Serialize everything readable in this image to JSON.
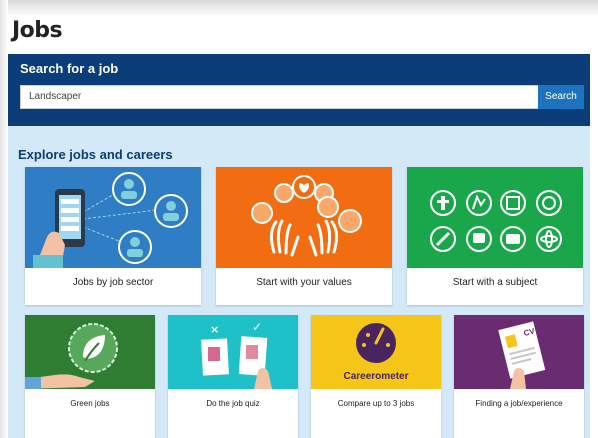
{
  "page": {
    "title": "Jobs"
  },
  "search": {
    "heading": "Search for a job",
    "value": "Landscaper",
    "button_label": "Search"
  },
  "explore": {
    "heading": "Explore jobs and careers",
    "cards": [
      {
        "label": "Jobs by job sector",
        "color": "#2f7dc4"
      },
      {
        "label": "Start with your values",
        "color": "#f26c11"
      },
      {
        "label": "Start with a subject",
        "color": "#1aa64b"
      }
    ],
    "tiles": [
      {
        "label": "Green jobs",
        "color": "#2e7d32"
      },
      {
        "label": "Do the job quiz",
        "color": "#1fc1c9"
      },
      {
        "label": "Compare up to 3 jobs",
        "color": "#f5c518",
        "art_text": "Careerometer"
      },
      {
        "label": "Finding a job/experience",
        "color": "#6a2c70",
        "art_text": "CV"
      }
    ]
  },
  "colors": {
    "header_bg": "#0b3d78",
    "explore_bg": "#d3e9f7",
    "search_button": "#1e73be"
  }
}
